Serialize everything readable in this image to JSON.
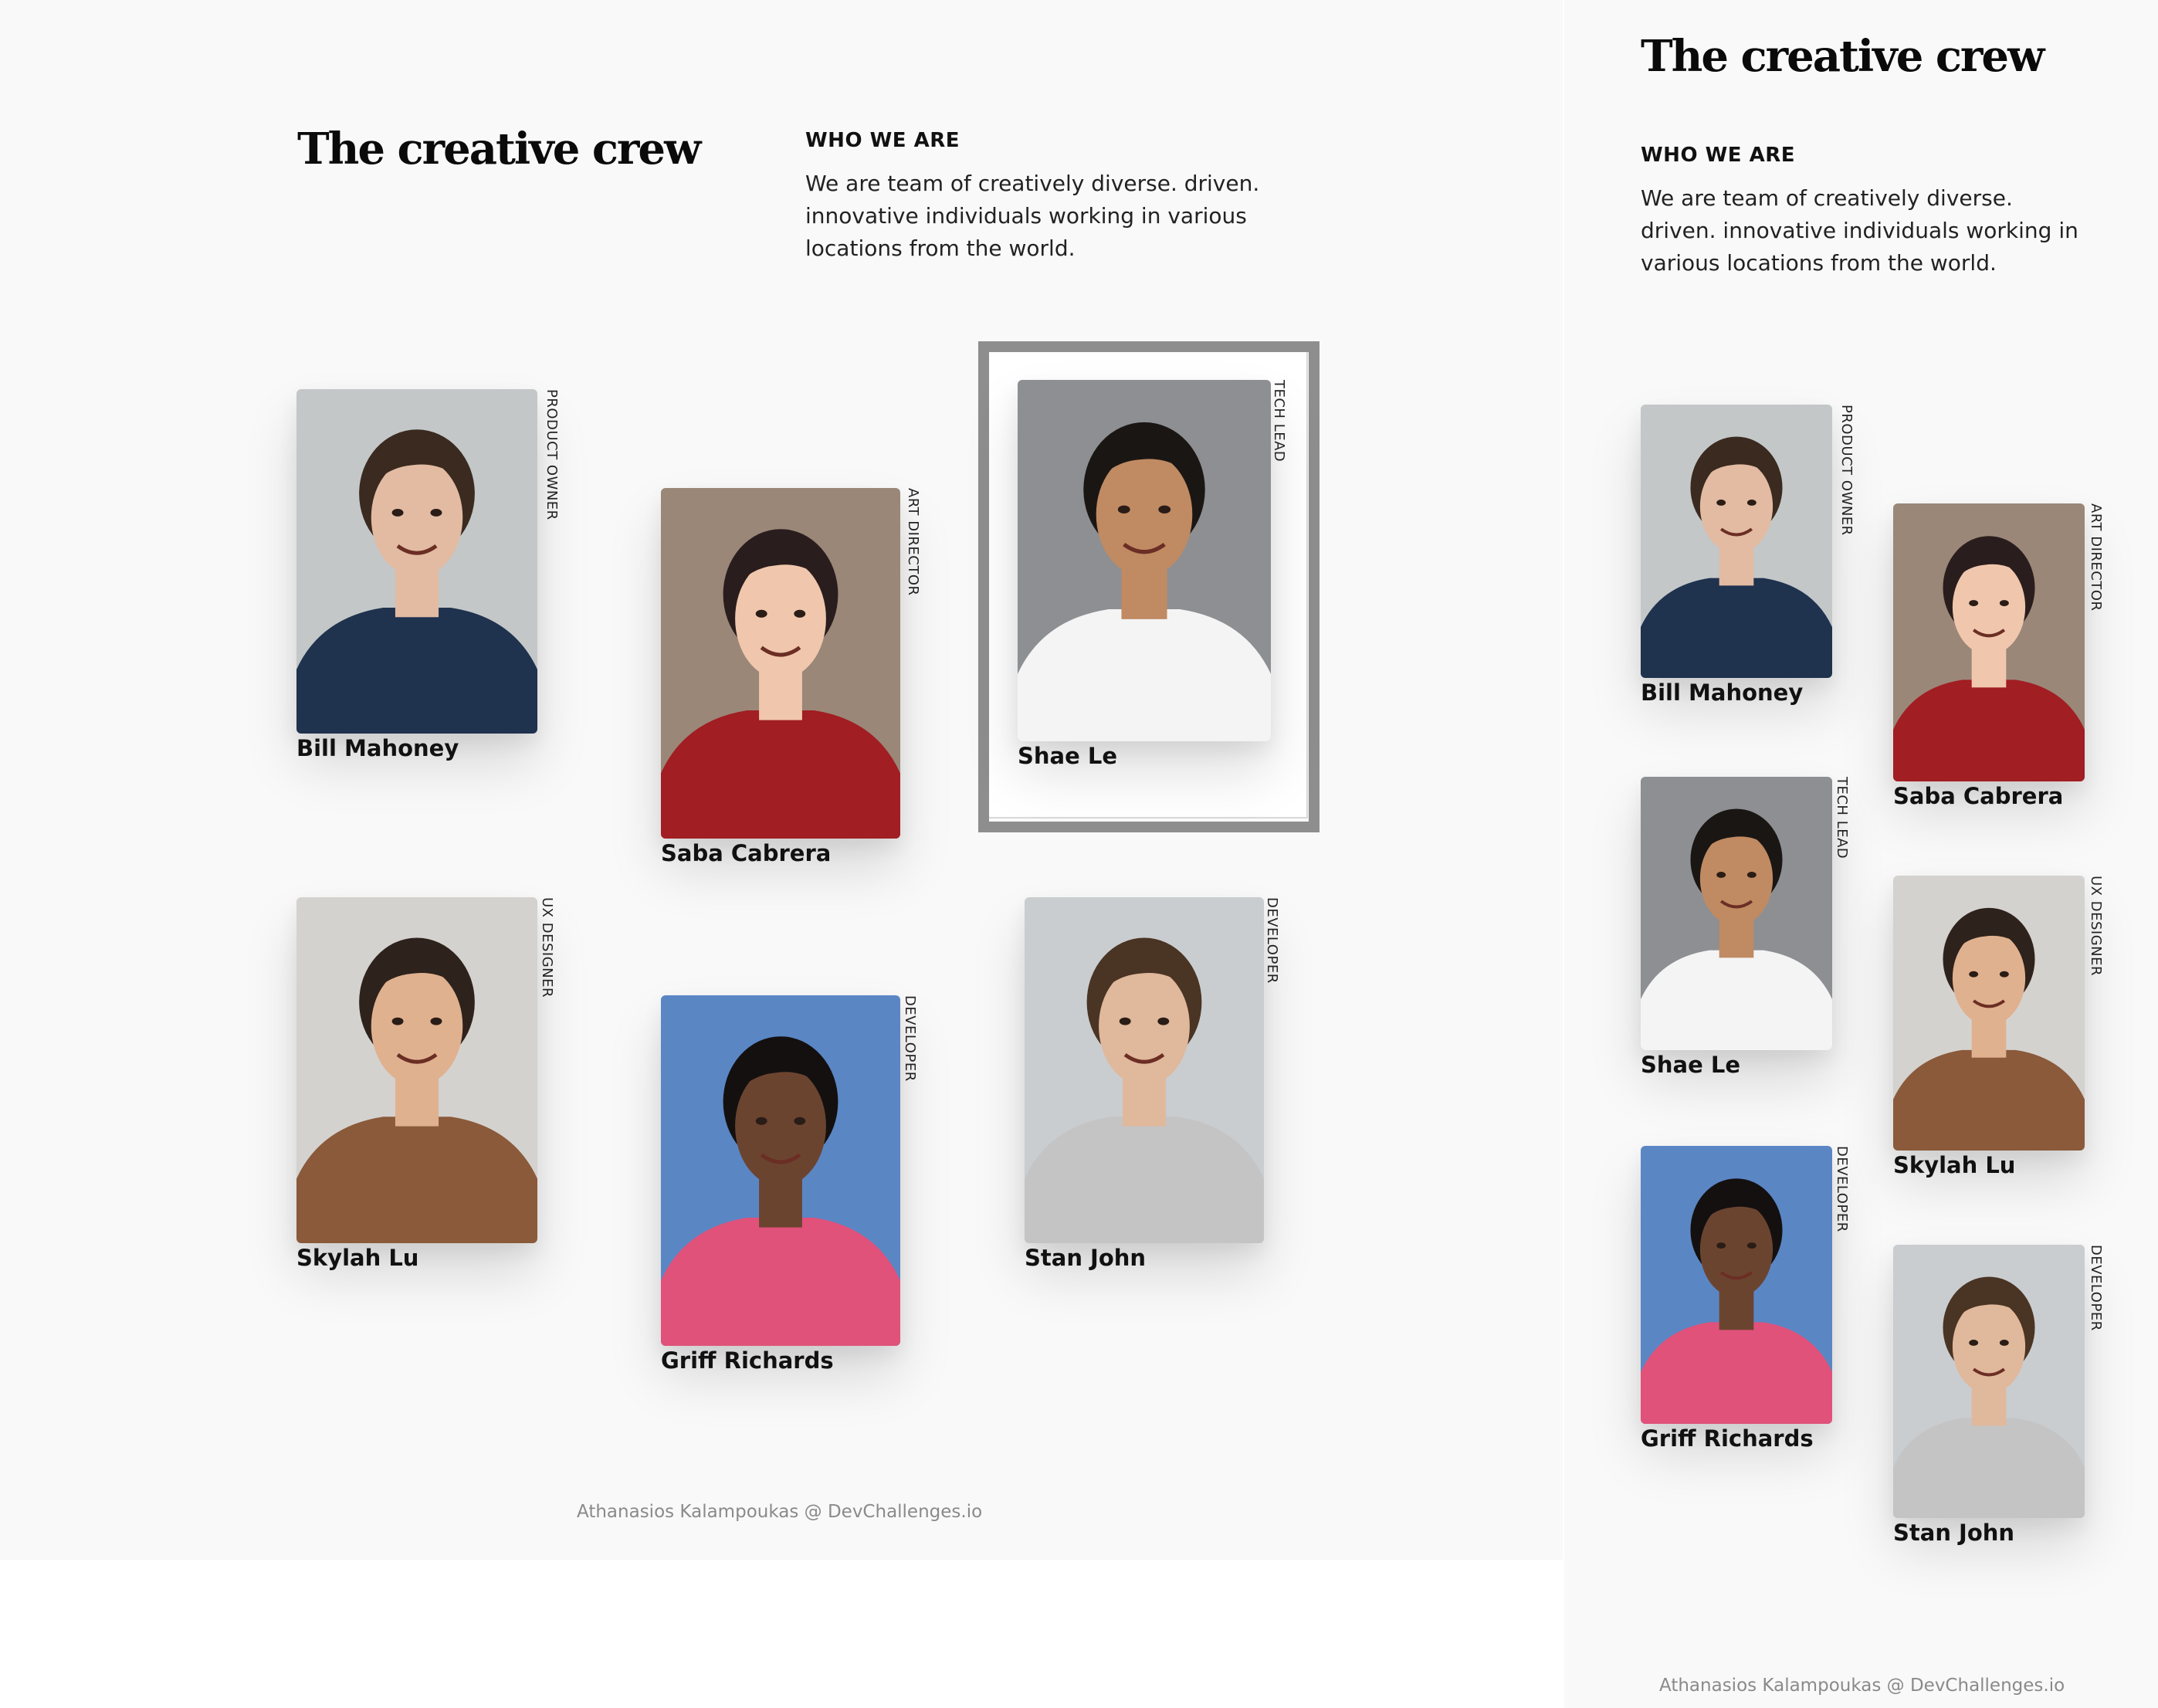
{
  "heading": {
    "title": "The creative crew",
    "who_label": "WHO WE ARE",
    "description_line1": "We are team of creatively diverse. driven.",
    "description_line2": "innovative individuals working in various",
    "description_line3": "locations from the world.",
    "mobile_line1": "We are team of creatively diverse.",
    "mobile_line2": "driven. innovative individuals working in",
    "mobile_line3": "various locations from the world."
  },
  "members": [
    {
      "name": "Bill Mahoney",
      "role": "PRODUCT OWNER",
      "bg": "#c3c7c8",
      "skin": "#e2bba2",
      "hair": "#3a2a20",
      "shirt": "#1f324e"
    },
    {
      "name": "Saba Cabrera",
      "role": "ART DIRECTOR",
      "bg": "#9a8778",
      "skin": "#f0c7ad",
      "hair": "#2a1d1d",
      "shirt": "#a11e22"
    },
    {
      "name": "Shae Le",
      "role": "TECH LEAD",
      "bg": "#8d8f92",
      "skin": "#c08a62",
      "hair": "#1a1614",
      "shirt": "#f4f4f4"
    },
    {
      "name": "Skylah Lu",
      "role": "UX DESIGNER",
      "bg": "#d4d2cf",
      "skin": "#e0b18f",
      "hair": "#2e221c",
      "shirt": "#8a5a3a"
    },
    {
      "name": "Griff Richards",
      "role": "DEVELOPER",
      "bg": "#5a86c4",
      "skin": "#6b4430",
      "hair": "#141010",
      "shirt": "#e0527a"
    },
    {
      "name": "Stan John",
      "role": "DEVELOPER",
      "bg": "#c9cdd0",
      "skin": "#e0b89b",
      "hair": "#4a3424",
      "shirt": "#c4c4c4"
    }
  ],
  "footer": {
    "credit": "Athanasios Kalampoukas @ DevChallenges.io"
  }
}
